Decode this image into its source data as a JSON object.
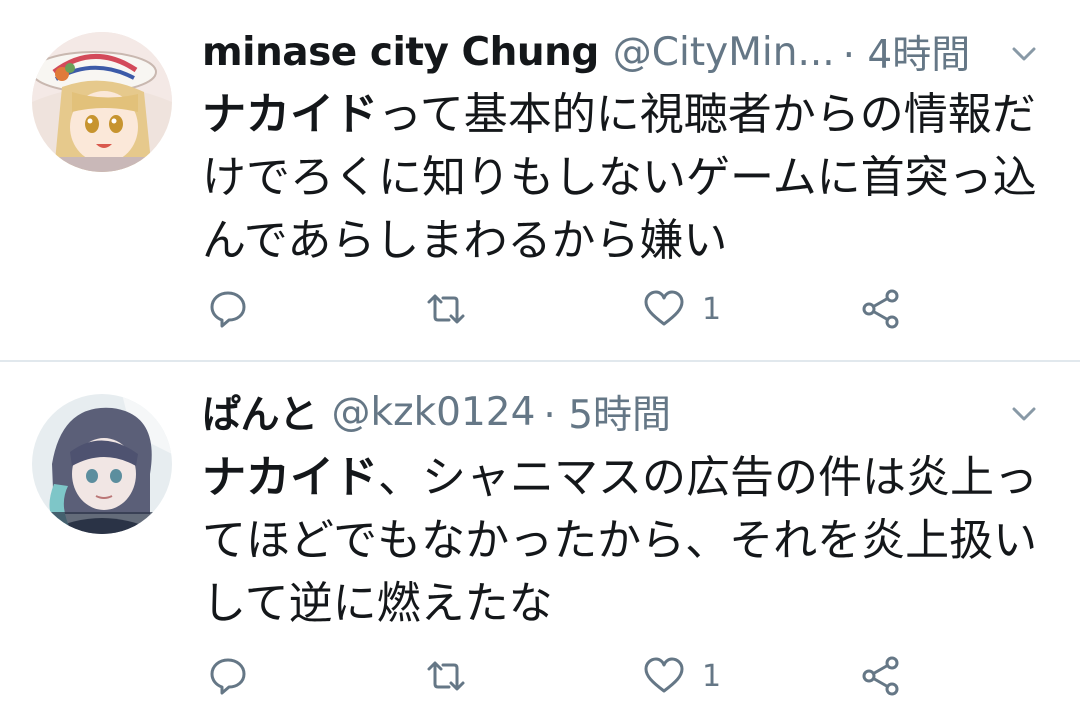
{
  "tweets": [
    {
      "name": "minase city Chung",
      "handle": "@CityMin...",
      "time": "· 4時間",
      "mention": "ナカイド",
      "lines": [
        "って基本的に視聴者からの情報だ",
        "けでろくに知りもしないゲームに首突っ込",
        "んであらしまわるから嫌い"
      ],
      "likes": "1"
    },
    {
      "name": "ぱんと",
      "handle": "@kzk0124",
      "time": "· 5時間",
      "mention": "ナカイド",
      "lines": [
        "、シャニマスの広告の件は炎上っ",
        "てほどでもなかったから、それを炎上扱い",
        "して逆に燃えたな"
      ],
      "likes": "1"
    }
  ],
  "icons": {
    "reply": "reply-icon",
    "retweet": "retweet-icon",
    "like": "heart-icon",
    "share": "share-icon",
    "menu": "chevron-down-icon"
  },
  "colors": {
    "text": "#14171a",
    "secondary": "#657786",
    "divider": "#e1e8ed"
  }
}
